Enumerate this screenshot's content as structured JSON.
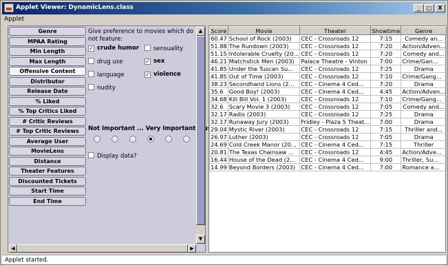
{
  "window": {
    "title": "Applet Viewer: DynamicLens.class",
    "controls": [
      "_",
      "□",
      "X"
    ]
  },
  "menu": {
    "label": "Applet"
  },
  "nav": {
    "items": [
      {
        "label": "Genre"
      },
      {
        "label": "MPAA Rating"
      },
      {
        "label": "Min Length"
      },
      {
        "label": "Max Length"
      },
      {
        "label": "Offensive Content",
        "active": true
      },
      {
        "label": "Distributor"
      },
      {
        "label": "Release Date"
      },
      {
        "label": "% Liked"
      },
      {
        "label": "% Top Critics Liked"
      },
      {
        "label": "# Critic Reviews"
      },
      {
        "label": "# Top Critic Reviews"
      },
      {
        "label": "Average User"
      },
      {
        "label": "MovieLens"
      },
      {
        "label": "Distance"
      },
      {
        "label": "Theater Features"
      },
      {
        "label": "Discounted Tickets"
      },
      {
        "label": "Start Time"
      },
      {
        "label": "End Time"
      }
    ]
  },
  "preferences": {
    "instruction": "Give preference to movies which do not feature:",
    "options": [
      {
        "label": "crude humor",
        "checked": true
      },
      {
        "label": "sensuality",
        "checked": false
      },
      {
        "label": "drug use",
        "checked": false
      },
      {
        "label": "sex",
        "checked": true
      },
      {
        "label": "language",
        "checked": false
      },
      {
        "label": "violence",
        "checked": true
      },
      {
        "label": "nudity",
        "checked": false
      }
    ],
    "scale_label": "Not Important ... Very Important Must",
    "importance_selected_index": 3,
    "importance_count": 6,
    "display_data_label": "Display data?",
    "display_data_checked": false
  },
  "results": {
    "columns": [
      "Score",
      "Movie",
      "Theater",
      "Showtime",
      "Genre"
    ],
    "rows": [
      [
        "60.47",
        "School of Rock (2003)",
        "CEC - Crossroads 12",
        "7:15",
        "Comedy an..."
      ],
      [
        "51.88",
        "The Rundown (2003)",
        "CEC - Crossroads 12",
        "7:20",
        "Action/Adven..."
      ],
      [
        "51.15",
        "Intolerable Cruelty (20...",
        "CEC - Crossroads 12",
        "7:20",
        "Comedy and..."
      ],
      [
        "46.21",
        "Matchstick Men (2003)",
        "Palace Theatre - Vinton",
        "7:00",
        "Crime/Gan..."
      ],
      [
        "41.85",
        "Under the Tuscan Su...",
        "CEC - Crossroads 12",
        "7:25",
        "Drama"
      ],
      [
        "41.85",
        "Out of Time (2003)",
        "CEC - Crossroads 12",
        "7:10",
        "Crime/Gang..."
      ],
      [
        "38.23",
        "Secondhand Lions (2...",
        "CEC - Cinema 4 Ced...",
        "7:20",
        "Drama"
      ],
      [
        "35.6",
        "Good Boy! (2003)",
        "CEC - Cinema 4 Ced...",
        "4:45",
        "Action/Adven..."
      ],
      [
        "34.68",
        "Kill Bill Vol. 1 (2003)",
        "CEC - Crossroads 12",
        "7:10",
        "Crime/Gang..."
      ],
      [
        "32.6",
        "Scary Movie 3 (2003)",
        "CEC - Crossroads 12",
        "7:05",
        "Comedy and..."
      ],
      [
        "32.17",
        "Radio (2003)",
        "CEC - Crossroads 12",
        "7:25",
        "Drama"
      ],
      [
        "32.17",
        "Runaway Jury (2003)",
        "Fridley - Plaza 5 Theat...",
        "7:00",
        "Drama"
      ],
      [
        "29.04",
        "Mystic River (2003)",
        "CEC - Crossroads 12",
        "7:15",
        "Thriller and..."
      ],
      [
        "26.97",
        "Luther (2003)",
        "CEC - Crossroads 12",
        "7:05",
        "Drama"
      ],
      [
        "24.69",
        "Cold Creek Manor (20...",
        "CEC - Cinema 4 Ced...",
        "7:15",
        "Thriller"
      ],
      [
        "20.81",
        "The Texas Chainsaw ...",
        "CEC - Crossroads 12",
        "4:45",
        "Action/Adve..."
      ],
      [
        "16.44",
        "House of the Dead (2...",
        "CEC - Cinema 4 Ced...",
        "9:00",
        "Thriller, Su..."
      ],
      [
        "14.99",
        "Beyond Borders (2003)",
        "CEC - Cinema 4 Ced...",
        "7:00",
        "Romance a..."
      ]
    ]
  },
  "status": {
    "text": "Applet started."
  },
  "icons": {
    "scroll_up": "▲",
    "scroll_down": "▼",
    "scroll_left": "◀",
    "scroll_right": "▶",
    "check": "✓"
  }
}
